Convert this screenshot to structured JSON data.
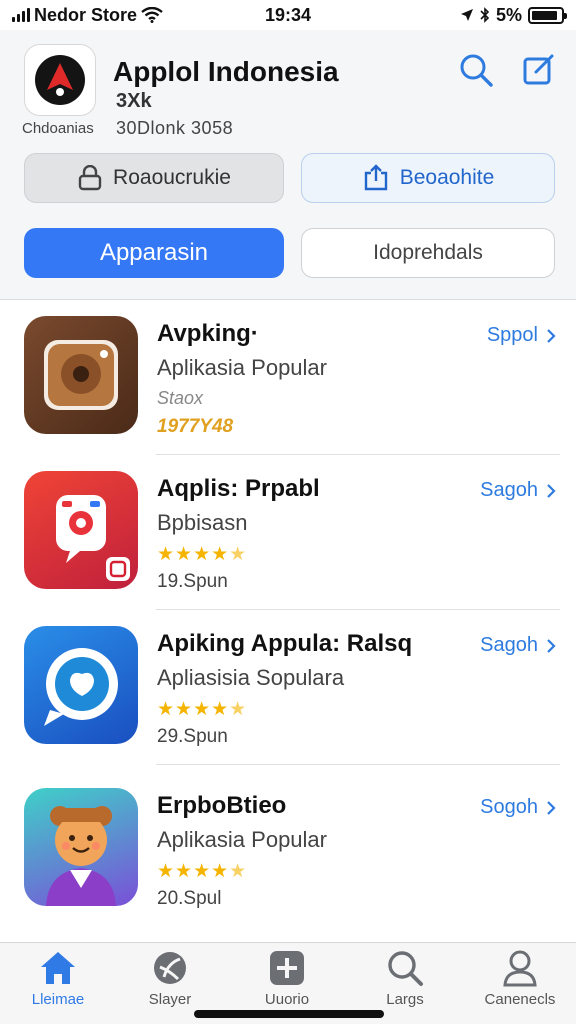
{
  "status": {
    "carrier": "Nedor Store",
    "time": "19:34",
    "battery": "5%"
  },
  "header": {
    "title": "Applol Indonesia",
    "subtitle": "3Xk",
    "meta_left": "Chdoanias",
    "meta_right": "30Dlonk 3058",
    "lock_button": "Roaoucrukie",
    "share_button": "Beoaohite",
    "apps_tab": "Apparasin",
    "indo_tab": "Idoprehdals",
    "accent_color": "#3478f6"
  },
  "apps": [
    {
      "name": "Avpking·",
      "category": "Aplikasia Popular",
      "line3": "Staox",
      "line4": "1977Y48",
      "action": "Sppol",
      "icon": "camera-app-icon"
    },
    {
      "name": "Aqplis: Prpabl",
      "category": "Bpbisasn",
      "rating_of_5": 4.5,
      "line4": "19.Spun",
      "action": "Sagoh",
      "icon": "instagram-style-icon"
    },
    {
      "name": "Apiking Appula: Ralsq",
      "category": "Apliasisia Sopulara",
      "rating_of_5": 4.5,
      "line4": "29.Spun",
      "action": "Sagoh",
      "icon": "chat-bubble-icon"
    },
    {
      "name": "ErpboBtieo",
      "category": "Aplikasia Popular",
      "rating_of_5": 4.5,
      "line4": "20.Spul",
      "action": "Sogoh",
      "icon": "bear-avatar-icon"
    }
  ],
  "tabbar": {
    "tabs": [
      {
        "label": "Lleimae",
        "icon": "home-icon"
      },
      {
        "label": "Slayer",
        "icon": "player-icon"
      },
      {
        "label": "Uuorio",
        "icon": "plus-icon"
      },
      {
        "label": "Largs",
        "icon": "search-icon"
      },
      {
        "label": "Canenecls",
        "icon": "person-icon"
      }
    ]
  }
}
